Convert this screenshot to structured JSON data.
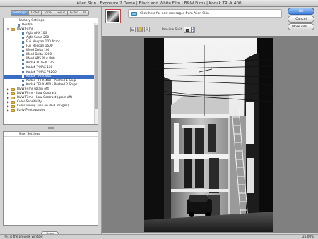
{
  "window": {
    "title": "Alien Skin | Exposure 2 Demo | Black and White Film | B&W Films | Kodak TRI-X 400"
  },
  "tabs": [
    {
      "label": "Settings",
      "active": true
    },
    {
      "label": "Color",
      "active": false
    },
    {
      "label": "Tone",
      "active": false
    },
    {
      "label": "Focus",
      "active": false
    },
    {
      "label": "Grain",
      "active": false
    },
    {
      "label": "IR",
      "active": false
    }
  ],
  "settings_tree": {
    "header": "Factory Settings",
    "items": [
      {
        "label": "Neutral",
        "type": "leaf",
        "level": 1,
        "selected": false
      },
      {
        "label": "B&W Films",
        "type": "folder",
        "level": 0,
        "expanded": true,
        "selected": false
      },
      {
        "label": "Agfa APX 100",
        "type": "leaf",
        "level": 2,
        "selected": false
      },
      {
        "label": "Agfa Scala 200",
        "type": "leaf",
        "level": 2,
        "selected": false
      },
      {
        "label": "Fuji Neopan 100 Acros",
        "type": "leaf",
        "level": 2,
        "selected": false
      },
      {
        "label": "Fuji Neopan 1600",
        "type": "leaf",
        "level": 2,
        "selected": false
      },
      {
        "label": "Ilford Delta 100",
        "type": "leaf",
        "level": 2,
        "selected": false
      },
      {
        "label": "Ilford Delta 3200",
        "type": "leaf",
        "level": 2,
        "selected": false
      },
      {
        "label": "Ilford HP5 Plus 400",
        "type": "leaf",
        "level": 2,
        "selected": false
      },
      {
        "label": "Kodak PLUS-X 125",
        "type": "leaf",
        "level": 2,
        "selected": false
      },
      {
        "label": "Kodak T-MAX 100",
        "type": "leaf",
        "level": 2,
        "selected": false
      },
      {
        "label": "Kodak T-MAX P3200",
        "type": "leaf",
        "level": 2,
        "selected": false
      },
      {
        "label": "Kodak TRI-X 400",
        "type": "leaf",
        "level": 2,
        "selected": true
      },
      {
        "label": "Kodak TRI-X 400 - Pushed 1 Stop",
        "type": "leaf",
        "level": 2,
        "selected": false
      },
      {
        "label": "Kodak TRI-X 400 - Pushed 2 Stops",
        "type": "leaf",
        "level": 2,
        "selected": false
      },
      {
        "label": "B&W Films (grain off)",
        "type": "folder",
        "level": 0,
        "expanded": false,
        "selected": false
      },
      {
        "label": "B&W Films - Low Contrast",
        "type": "folder",
        "level": 0,
        "expanded": false,
        "selected": false
      },
      {
        "label": "B&W Films - Low Contrast (grain off)",
        "type": "folder",
        "level": 0,
        "expanded": false,
        "selected": false
      },
      {
        "label": "Color Sensitivity",
        "type": "folder",
        "level": 0,
        "expanded": false,
        "selected": false
      },
      {
        "label": "Color Toning (use on RGB images)",
        "type": "folder",
        "level": 0,
        "expanded": false,
        "selected": false
      },
      {
        "label": "Early Photography",
        "type": "folder",
        "level": 0,
        "expanded": false,
        "selected": false
      }
    ]
  },
  "user_settings": {
    "header": "User Settings",
    "save_label": "Save"
  },
  "toolbar": {
    "messages_text": "Click here for new messages from Alien Skin",
    "preview_split_label": "Preview Split"
  },
  "actions": {
    "ok_label": "OK",
    "cancel_label": "Cancel",
    "more_info_label": "More info..."
  },
  "status": {
    "message": "This is the preview window",
    "zoom": "25.00%"
  }
}
